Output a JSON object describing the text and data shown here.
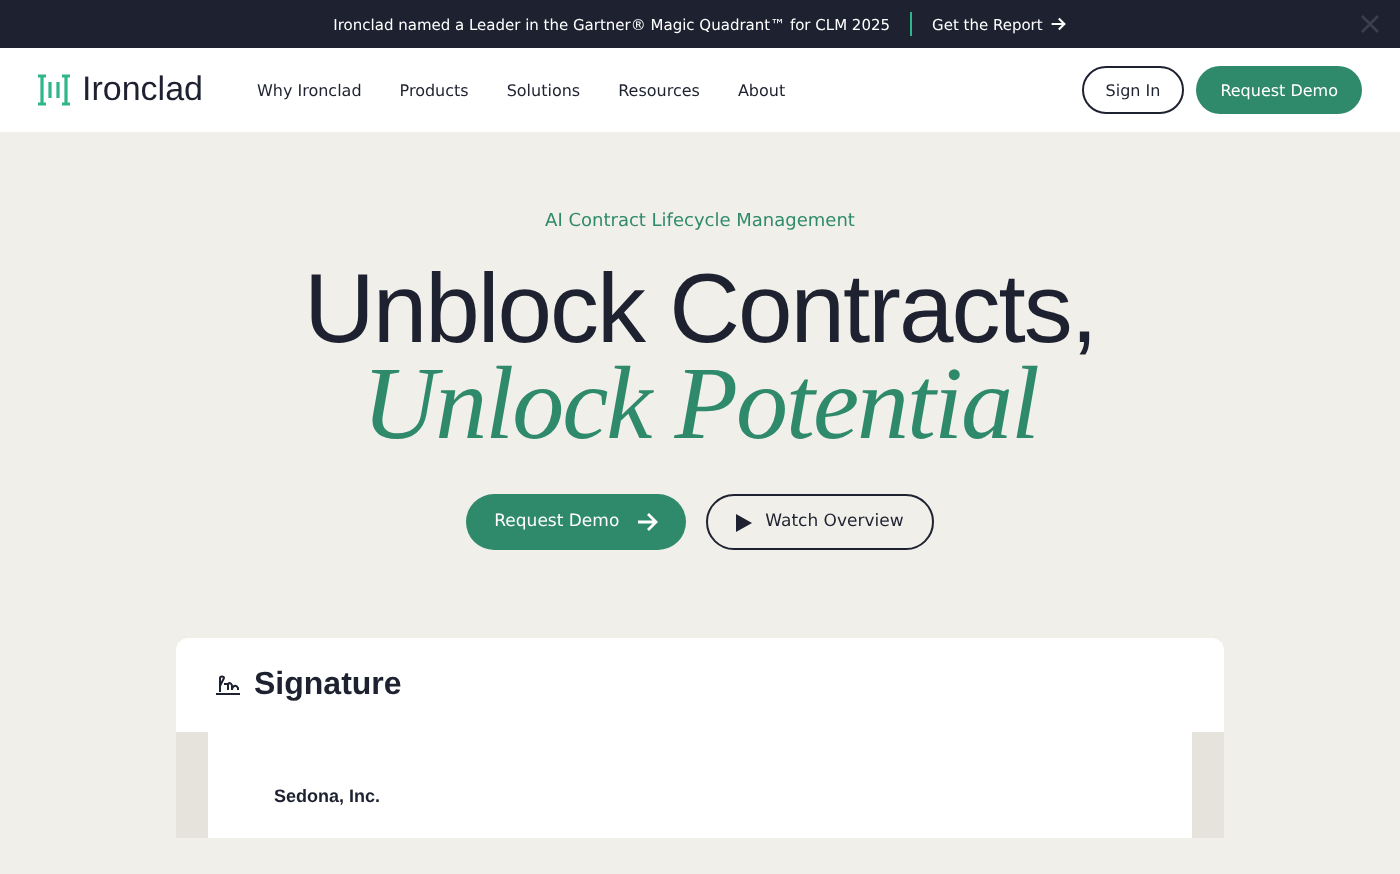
{
  "banner": {
    "text": "Ironclad named a Leader in the Gartner® Magic Quadrant™ for CLM 2025",
    "link": "Get the Report"
  },
  "nav": {
    "logo": "Ironclad",
    "links": [
      "Why Ironclad",
      "Products",
      "Solutions",
      "Resources",
      "About"
    ],
    "sign_in": "Sign In",
    "cta": "Request Demo"
  },
  "hero": {
    "eyebrow": "AI Contract Lifecycle Management",
    "title": "Unblock Contracts,",
    "subtitle": "Unlock Potential",
    "primary": "Request Demo",
    "secondary": "Watch Overview"
  },
  "card": {
    "title": "Signature",
    "company": "Sedona, Inc."
  }
}
